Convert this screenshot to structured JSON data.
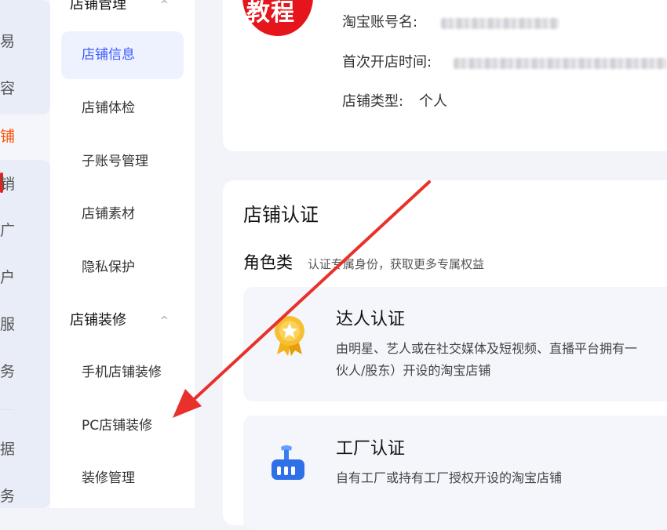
{
  "rail": {
    "items": [
      "易",
      "容",
      "铺",
      "销",
      "广",
      "户",
      "服",
      "务",
      "据",
      "务"
    ],
    "active_index": 2
  },
  "subnav": {
    "group1_title": "店铺管理",
    "group1_items": [
      "店铺信息",
      "店铺体检",
      "子账号管理",
      "店铺素材",
      "隐私保护"
    ],
    "group2_title": "店铺装修",
    "group2_items": [
      "手机店铺装修",
      "PC店铺装修",
      "装修管理"
    ],
    "chevron": "^"
  },
  "profile": {
    "logo_text": "教程",
    "account_label": "淘宝账号名:",
    "open_time_label": "首次开店时间:",
    "shop_type_label": "店铺类型:",
    "shop_type_value": "个人"
  },
  "certification": {
    "title": "店铺认证",
    "role_title": "角色类",
    "role_desc": "认证专属身份，获取更多专属权益",
    "items": [
      {
        "title": "达人认证",
        "desc_line1": "由明星、艺人或在社交媒体及短视频、直播平台拥有一",
        "desc_line2": "伙人/股东）开设的淘宝店铺",
        "icon": "medal-icon"
      },
      {
        "title": "工厂认证",
        "desc_line1": "自有工厂或持有工厂授权开设的淘宝店铺",
        "icon": "factory-icon"
      }
    ]
  },
  "colors": {
    "accent": "#3d5afe",
    "brand": "#ff5000",
    "annotation_arrow": "#e8312a",
    "logo_red": "#e5151b"
  }
}
